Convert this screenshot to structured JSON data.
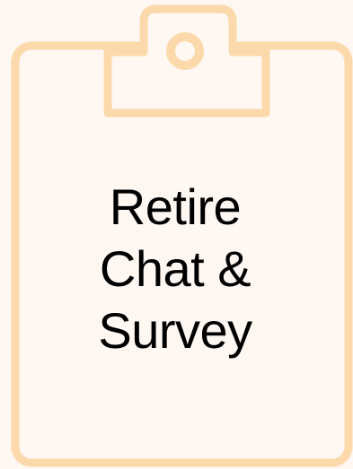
{
  "clipboard": {
    "lines": [
      "Retire",
      "Chat &",
      "Survey"
    ],
    "colors": {
      "background": "#fff7f1",
      "outline": "#fbd9aa",
      "text": "#000000"
    },
    "icon": "clipboard-icon"
  }
}
